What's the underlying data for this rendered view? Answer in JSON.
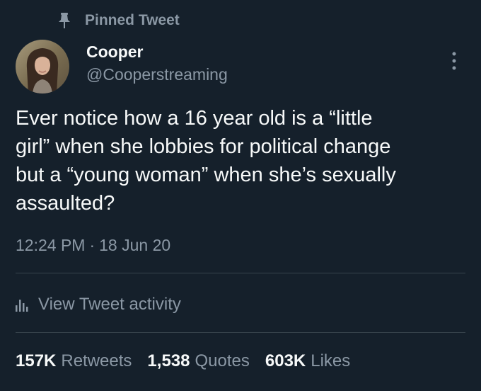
{
  "pinned": {
    "icon": "pin-icon",
    "label": "Pinned Tweet"
  },
  "author": {
    "display_name": "Cooper",
    "handle": "@Cooperstreaming",
    "avatar_icon": "avatar"
  },
  "tweet": {
    "text": "Ever notice how a 16 year old is a “little\ngirl” when she lobbies for political change\nbut a “young woman” when she’s sexually\nassaulted?",
    "time": "12:24 PM",
    "separator": "·",
    "date": "18 Jun 20"
  },
  "activity": {
    "icon": "analytics-icon",
    "label": "View Tweet activity"
  },
  "stats": {
    "retweets_count": "157K",
    "retweets_label": "Retweets",
    "quotes_count": "1,538",
    "quotes_label": "Quotes",
    "likes_count": "603K",
    "likes_label": "Likes"
  },
  "colors": {
    "background": "#15202b",
    "primary_text": "#f7f9f9",
    "secondary_text": "#8b98a5",
    "divider": "#38444d"
  }
}
